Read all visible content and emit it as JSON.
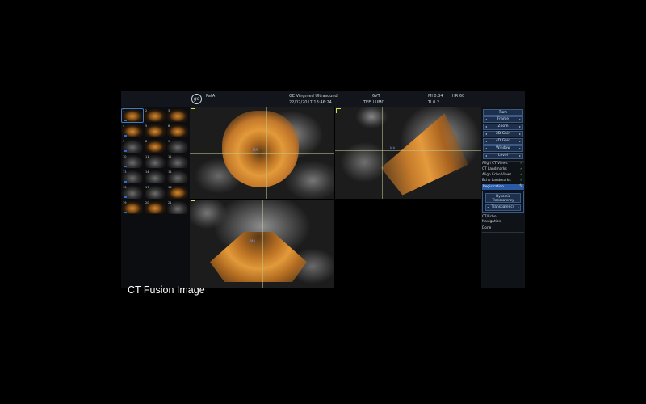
{
  "header": {
    "patient": "PatA",
    "system": "GE Vingmed Ultrasound",
    "datetime": "22/02/2017 13:46:24",
    "probe": "6VT",
    "mode": "TEE",
    "site": "LUMC",
    "mi": "MI 0.34",
    "ti": "TI 0.2",
    "hr": "HR 60",
    "logo_icon": "ge-logo-icon"
  },
  "thumbnails": [
    {
      "num": "1"
    },
    {
      "num": "2"
    },
    {
      "num": "3"
    },
    {
      "num": "4"
    },
    {
      "num": "5"
    },
    {
      "num": "6"
    },
    {
      "num": "7"
    },
    {
      "num": "8"
    },
    {
      "num": "9"
    },
    {
      "num": "10"
    },
    {
      "num": "11"
    },
    {
      "num": "12"
    },
    {
      "num": "13"
    },
    {
      "num": "14"
    },
    {
      "num": "15"
    },
    {
      "num": "16"
    },
    {
      "num": "17"
    },
    {
      "num": "18"
    },
    {
      "num": "19"
    },
    {
      "num": "20"
    },
    {
      "num": "21"
    }
  ],
  "views": {
    "top_left_label": "MA",
    "top_right_label": "MA",
    "bottom_label": "MA"
  },
  "panel": {
    "run": "Run",
    "controls": [
      "Frame",
      "Zoom",
      "2D Gain",
      "4D Gain",
      "Window",
      "Level"
    ],
    "checks": [
      "Align CT Views",
      "CT Landmarks",
      "Align Echo Views",
      "Echo Landmarks"
    ],
    "registration": "Registration",
    "dynamic_transparency": "Dynamic Transparency",
    "transparency": "Transparency",
    "ct_echo": "CT/Echo",
    "navigation": "Navigation",
    "done": "Done"
  },
  "colors": {
    "accent": "#2a5aa5",
    "check": "#46c35a",
    "overlay_orange": "#d78a2e"
  },
  "caption": "CT Fusion Image"
}
